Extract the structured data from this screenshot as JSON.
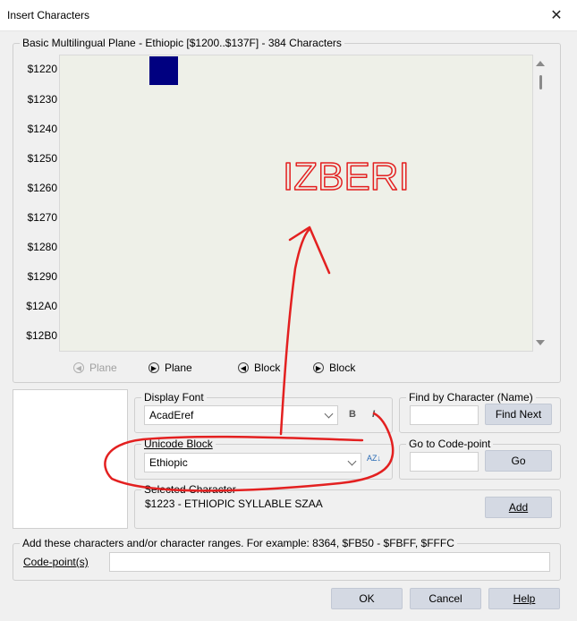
{
  "window": {
    "title": "Insert Characters"
  },
  "charmap": {
    "legend": "Basic Multilingual Plane - Ethiopic [$1200..$137F] - 384 Characters",
    "rows": [
      "$1220",
      "$1230",
      "$1240",
      "$1250",
      "$1260",
      "$1270",
      "$1280",
      "$1290",
      "$12A0",
      "$12B0"
    ]
  },
  "nav": {
    "prev_plane": "Plane",
    "next_plane": "Plane",
    "prev_block": "Block",
    "next_block": "Block"
  },
  "display_font": {
    "legend": "Display Font",
    "value": "AcadEref",
    "bold": "B",
    "italic": "I"
  },
  "unicode_block": {
    "legend": "Unicode Block",
    "value": "Ethiopic",
    "sort_label": "AZ"
  },
  "find": {
    "legend": "Find by Character (Name)",
    "button": "Find Next"
  },
  "goto": {
    "legend": "Go to Code-point",
    "button": "Go"
  },
  "selected": {
    "legend": "Selected Character",
    "value": "$1223 - ETHIOPIC SYLLABLE SZAA",
    "add": "Add"
  },
  "ranges": {
    "legend": "Add these characters and/or character ranges. For example: 8364, $FB50 - $FBFF, $FFFC",
    "label": "Code-point(s)"
  },
  "footer": {
    "ok": "OK",
    "cancel": "Cancel",
    "help": "Help"
  },
  "annotation": {
    "text": "IZBERI",
    "color": "#e32020"
  }
}
